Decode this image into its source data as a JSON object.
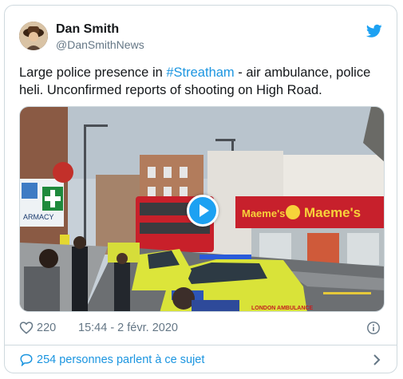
{
  "author": {
    "name": "Dan Smith",
    "handle": "@DanSmithNews"
  },
  "tweet": {
    "text_before": "Large police presence in ",
    "hashtag": "#Streatham",
    "text_after": " - air ambulance, police heli. Unconfirmed reports of shooting on High Road."
  },
  "media": {
    "shop_sign": "Maeme's",
    "shop_sign_short": "Maeme's",
    "vehicle_text": "LONDON AMBULANCE",
    "pharmacy_text": "ARMACY"
  },
  "meta": {
    "likes": "220",
    "timestamp": "15:44 - 2 févr. 2020"
  },
  "footer": {
    "conversation_label": "254 personnes parlent à ce sujet"
  },
  "colors": {
    "accent": "#1da1f2",
    "link": "#1b95e0",
    "muted": "#657786",
    "border": "#cfd9de"
  },
  "icons": [
    "twitter-bird-icon",
    "heart-icon",
    "info-icon",
    "speech-bubble-icon",
    "chevron-right-icon",
    "play-icon"
  ]
}
